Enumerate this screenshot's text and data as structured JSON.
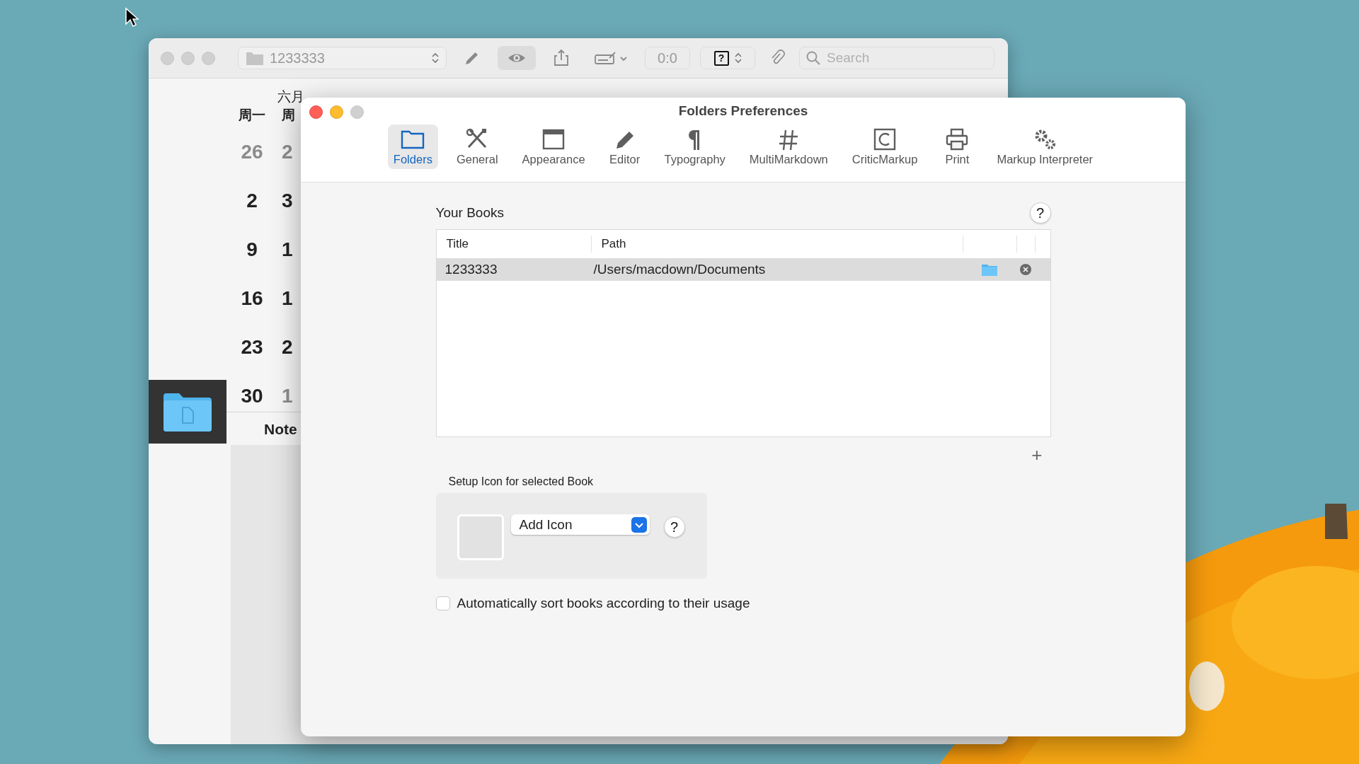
{
  "back_window": {
    "toolbar": {
      "document": "1233333",
      "tools": [
        {
          "kind": "pencil",
          "selected": false
        },
        {
          "kind": "eye",
          "selected": true
        },
        {
          "kind": "share",
          "selected": false
        },
        {
          "kind": "signature-menu",
          "selected": false
        }
      ],
      "counter": "0:0",
      "help_popup": "?",
      "search": {
        "placeholder": "Search"
      }
    },
    "sidebar_items": [
      {
        "selected": true
      }
    ],
    "calendar": {
      "month": "六月",
      "weekdays": [
        "周一",
        "周"
      ],
      "weeks": [
        [
          {
            "day": "26",
            "muted": true
          },
          {
            "day": "2",
            "muted": true
          }
        ],
        [
          {
            "day": "2",
            "muted": false
          },
          {
            "day": "3",
            "muted": false
          }
        ],
        [
          {
            "day": "9",
            "muted": false
          },
          {
            "day": "1",
            "muted": false
          }
        ],
        [
          {
            "day": "16",
            "muted": false
          },
          {
            "day": "1",
            "muted": false
          }
        ],
        [
          {
            "day": "23",
            "muted": false
          },
          {
            "day": "2",
            "muted": false
          }
        ],
        [
          {
            "day": "30",
            "muted": false
          },
          {
            "day": "1",
            "muted": true
          }
        ]
      ]
    },
    "notes_heading": "Note"
  },
  "preferences_window": {
    "title": "Folders Preferences",
    "tabs": [
      {
        "label": "Folders",
        "kind": "folder",
        "selected": true
      },
      {
        "label": "General",
        "kind": "tools",
        "selected": false
      },
      {
        "label": "Appearance",
        "kind": "window",
        "selected": false
      },
      {
        "label": "Editor",
        "kind": "pencil",
        "selected": false
      },
      {
        "label": "Typography",
        "kind": "pilcrow",
        "selected": false
      },
      {
        "label": "MultiMarkdown",
        "kind": "hash",
        "selected": false
      },
      {
        "label": "CriticMarkup",
        "kind": "cbox",
        "selected": false
      },
      {
        "label": "Print",
        "kind": "printer",
        "selected": false
      },
      {
        "label": "Markup Interpreter",
        "kind": "gears",
        "selected": false
      }
    ],
    "books": {
      "heading": "Your Books",
      "help": "?",
      "columns": [
        "Title",
        "Path"
      ],
      "rows": [
        {
          "title": "1233333",
          "path": "/Users/macdown/Documents",
          "selected": true
        }
      ],
      "add": "+"
    },
    "icon_setup": {
      "label": "Setup Icon for selected Book",
      "popup": "Add Icon",
      "help": "?"
    },
    "sort_option": {
      "label": "Automatically sort books according to their usage",
      "checked": false
    }
  }
}
